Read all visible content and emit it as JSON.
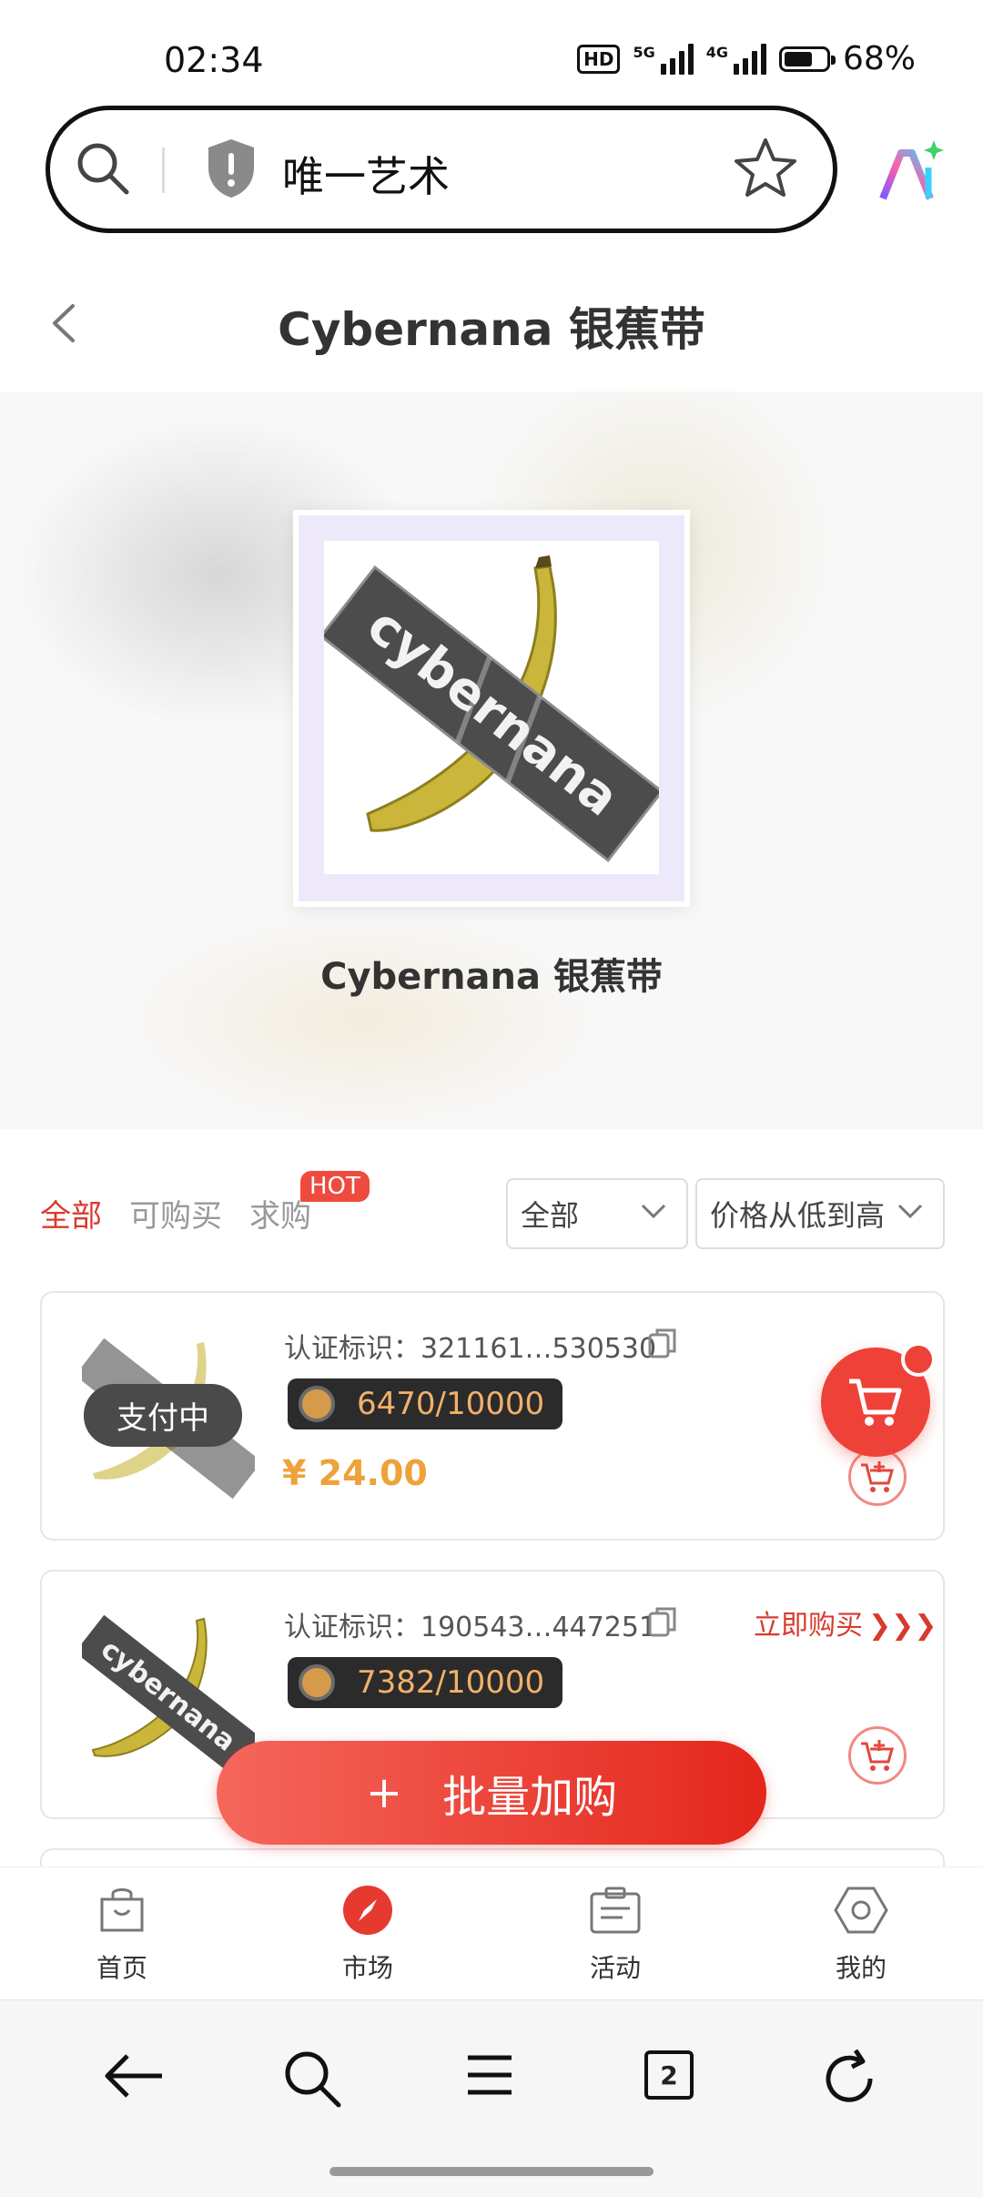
{
  "status_bar": {
    "time": "02:34",
    "hd_label": "HD",
    "net1": "5G",
    "net2": "4G",
    "battery": "68%",
    "battery_level": 0.68
  },
  "browser": {
    "search_text": "唯一艺术"
  },
  "page": {
    "title": "Cybernana 银蕉带"
  },
  "hero": {
    "nft_name": "Cybernana 银蕉带",
    "tape_text": "cybernana"
  },
  "filters": {
    "tabs": [
      "全部",
      "可购买",
      "求购"
    ],
    "hot_badge": "HOT",
    "dropdown_category": "全部",
    "dropdown_sort": "价格从低到高"
  },
  "listings": [
    {
      "cert_label": "认证标识：",
      "cert_id": "321161…530530",
      "serial": "6470/10000",
      "price": "¥ 24.00",
      "status": "支付中"
    },
    {
      "cert_label": "认证标识：",
      "cert_id": "190543…447251",
      "serial": "7382/10000",
      "buy_now": "立即购买"
    }
  ],
  "batch_button": {
    "plus": "+",
    "label": "批量加购"
  },
  "app_nav": [
    {
      "label": "首页",
      "icon": "shopping-bag-icon"
    },
    {
      "label": "市场",
      "icon": "compass-icon"
    },
    {
      "label": "活动",
      "icon": "clipboard-icon"
    },
    {
      "label": "我的",
      "icon": "hexagon-icon"
    }
  ],
  "browser_toolbar": {
    "tab_count": "2"
  },
  "colors": {
    "accent_red": "#d93a2e",
    "price_orange": "#eda23a",
    "serial_text": "#f2b06b"
  }
}
